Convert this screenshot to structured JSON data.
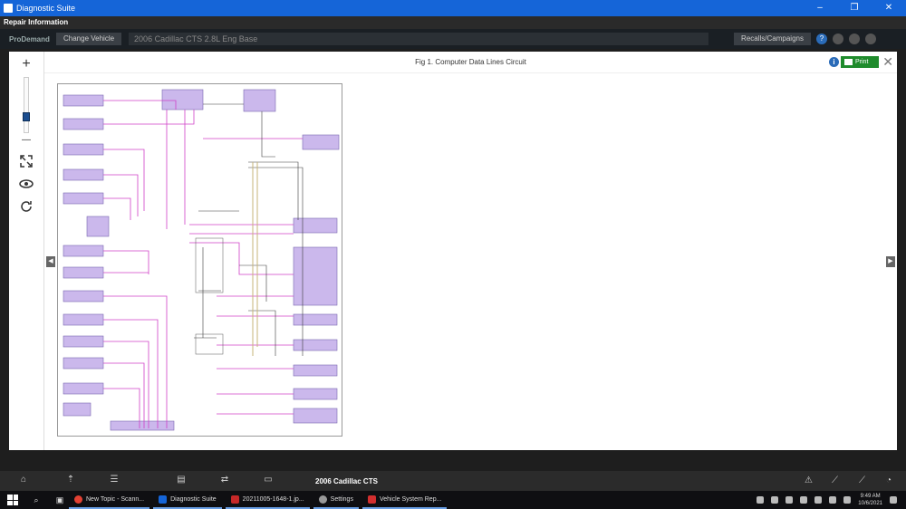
{
  "window": {
    "title": "Diagnostic Suite",
    "controls": [
      "–",
      "❐",
      "✕"
    ]
  },
  "repair_bar": {
    "title": "Repair Information"
  },
  "nav": {
    "brand": "ProDemand",
    "change_vehicle": "Change Vehicle",
    "vehicle": "2006 Cadillac CTS 2.8L Eng Base",
    "recalls": "Recalls/Campaigns",
    "help": "?"
  },
  "viewer": {
    "title": "Fig 1. Computer Data Lines Circuit",
    "info": "i",
    "print": "Print",
    "close": "✕",
    "zoom_in": "+",
    "zoom_out": "—",
    "zoom_level": 0.25,
    "left_arrow": "◀",
    "right_arrow": "▶"
  },
  "app_taskbar": {
    "vehicle_label": "2006 Cadillac CTS"
  },
  "win_taskbar": {
    "items": [
      {
        "label": "New Topic - Scann...",
        "color": "#e34133"
      },
      {
        "label": "Diagnostic Suite",
        "color": "#1565d8"
      },
      {
        "label": "20211005-1648-1.jp...",
        "color": "#c62828"
      },
      {
        "label": "Settings",
        "color": "#999999"
      },
      {
        "label": "Vehicle System Rep...",
        "color": "#d32f2f"
      }
    ],
    "time": "9:49 AM",
    "date": "10/6/2021"
  }
}
